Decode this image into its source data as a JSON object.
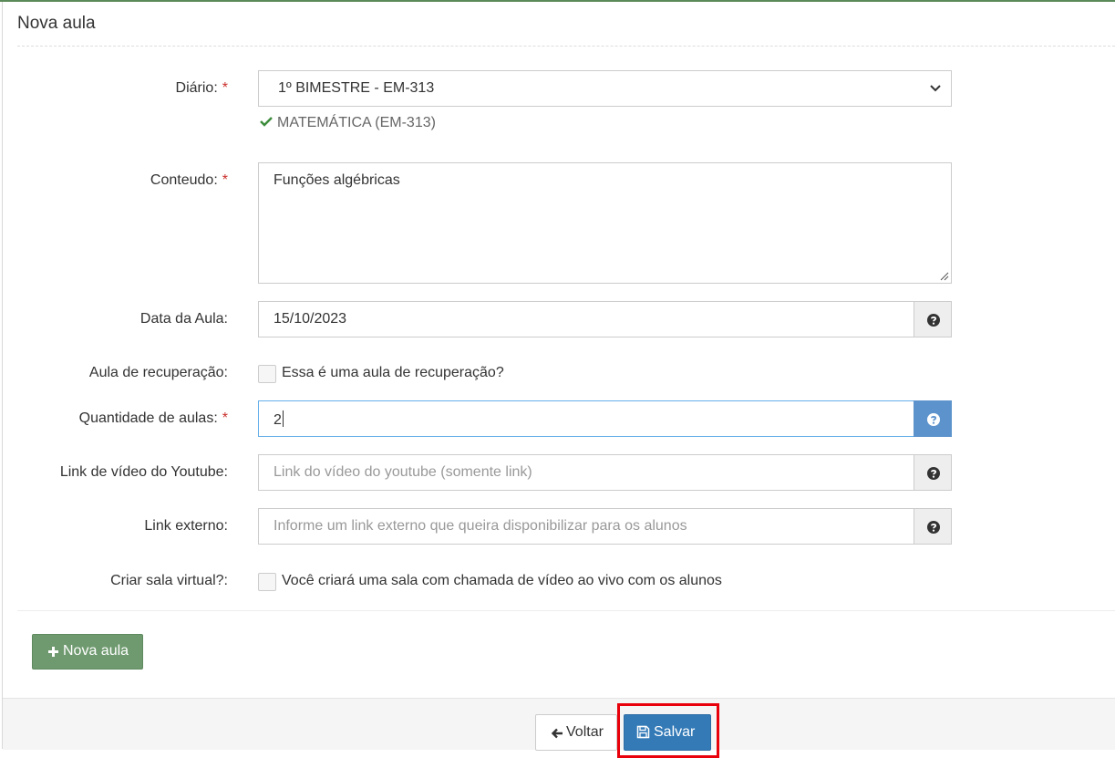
{
  "panel": {
    "title": "Nova aula"
  },
  "form": {
    "diario": {
      "label": "Diário:",
      "required_mark": "*",
      "selected": "1º BIMESTRE - EM-313",
      "info": "MATEMÁTICA (EM-313)"
    },
    "conteudo": {
      "label": "Conteudo:",
      "required_mark": "*",
      "value": "Funções algébricas"
    },
    "data_aula": {
      "label": "Data da Aula:",
      "value": "15/10/2023"
    },
    "recuperacao": {
      "label": "Aula de recuperação:",
      "checkbox_label": "Essa é uma aula de recuperação?",
      "checked": false
    },
    "quantidade": {
      "label": "Quantidade de aulas:",
      "required_mark": "*",
      "value": "2"
    },
    "youtube": {
      "label": "Link de vídeo do Youtube:",
      "placeholder": "Link do vídeo do youtube (somente link)"
    },
    "link_externo": {
      "label": "Link externo:",
      "placeholder": "Informe um link externo que queira disponibilizar para os alunos"
    },
    "sala_virtual": {
      "label": "Criar sala virtual?:",
      "checkbox_label": "Você criará uma sala com chamada de vídeo ao vivo com os alunos",
      "checked": false
    }
  },
  "actions": {
    "nova_aula": "Nova aula",
    "voltar": "Voltar",
    "salvar": "Salvar"
  },
  "colors": {
    "primary": "#337ab7",
    "success": "#6f9a6f",
    "required": "#c9302c",
    "highlight": "#e8000b"
  }
}
